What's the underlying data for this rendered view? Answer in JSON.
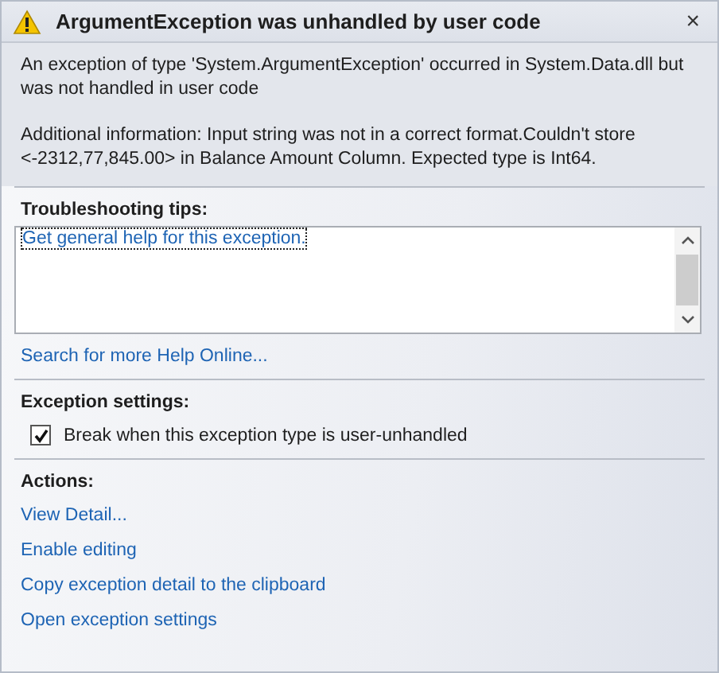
{
  "window": {
    "title": "ArgumentException was unhandled by user code",
    "close": "×"
  },
  "message": "An exception of type 'System.ArgumentException' occurred in System.Data.dll but was not handled in user code",
  "additional_info": "Additional information: Input string was not in a correct format.Couldn't store <-2312,77,845.00> in Balance Amount Column.  Expected type is Int64.",
  "troubleshooting": {
    "heading": "Troubleshooting tips:",
    "tips": [
      {
        "label": "Get general help for this exception.",
        "selected": true
      }
    ],
    "search_link": "Search for more Help Online..."
  },
  "exception_settings": {
    "heading": "Exception settings:",
    "checkbox": {
      "label": "Break when this exception type is user-unhandled",
      "checked": true
    }
  },
  "actions": {
    "heading": "Actions:",
    "links": [
      "View Detail...",
      "Enable editing",
      "Copy exception detail to the clipboard",
      "Open exception settings"
    ]
  }
}
